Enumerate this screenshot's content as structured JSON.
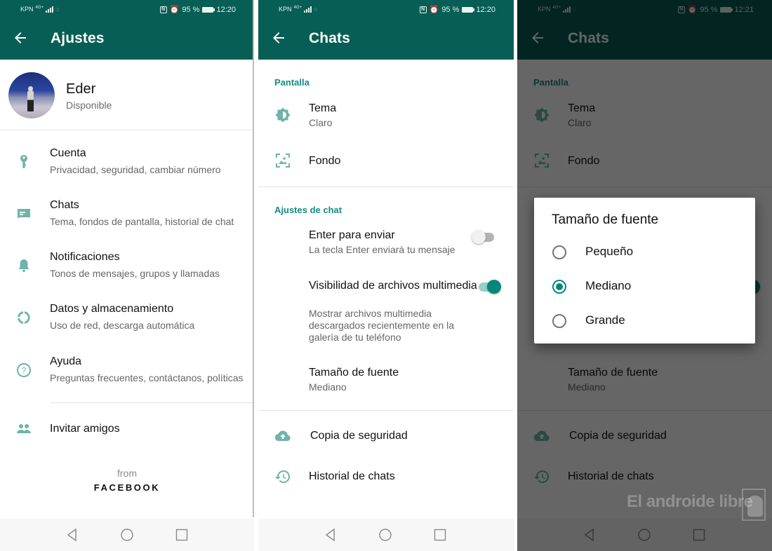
{
  "colors": {
    "primary_dark": "#075e54",
    "accent": "#00897b",
    "section_header": "#128c7e",
    "icon_tint": "#6fb3a8"
  },
  "panels": [
    {
      "status": {
        "carrier": "KPN",
        "network": "4G+",
        "battery": "95 %",
        "time": "12:20"
      },
      "appbar": {
        "title": "Ajustes",
        "back_icon": "arrow-left-icon"
      },
      "profile": {
        "name": "Eder",
        "status": "Disponible"
      },
      "items": [
        {
          "title": "Cuenta",
          "subtitle": "Privacidad, seguridad, cambiar número",
          "icon": "key-icon"
        },
        {
          "title": "Chats",
          "subtitle": "Tema, fondos de pantalla, historial de chat",
          "icon": "chat-icon"
        },
        {
          "title": "Notificaciones",
          "subtitle": "Tonos de mensajes, grupos y llamadas",
          "icon": "bell-icon"
        },
        {
          "title": "Datos y almacenamiento",
          "subtitle": "Uso de red, descarga automática",
          "icon": "data-usage-icon"
        },
        {
          "title": "Ayuda",
          "subtitle": "Preguntas frecuentes, contáctanos, políticas",
          "icon": "help-icon"
        },
        {
          "title": "Invitar amigos",
          "subtitle": "",
          "icon": "people-icon"
        }
      ],
      "footer": {
        "from": "from",
        "brand": "FACEBOOK"
      }
    },
    {
      "status": {
        "carrier": "KPN",
        "network": "4G+",
        "battery": "95 %",
        "time": "12:20"
      },
      "appbar": {
        "title": "Chats",
        "back_icon": "arrow-left-icon"
      },
      "sections": {
        "display_header": "Pantalla",
        "chat_settings_header": "Ajustes de chat"
      },
      "items": {
        "theme": {
          "title": "Tema",
          "subtitle": "Claro"
        },
        "wallpaper": {
          "title": "Fondo"
        },
        "enter_send": {
          "title": "Enter para enviar",
          "subtitle": "La tecla Enter enviará tu mensaje",
          "enabled": false
        },
        "media_visibility": {
          "title": "Visibilidad de archivos multimedia",
          "subtitle": "Mostrar archivos multimedia descargados recientemente en la galería de tu teléfono",
          "enabled": true
        },
        "font_size": {
          "title": "Tamaño de fuente",
          "subtitle": "Mediano"
        },
        "backup": {
          "title": "Copia de seguridad"
        },
        "history": {
          "title": "Historial de chats"
        }
      }
    },
    {
      "status": {
        "carrier": "KPN",
        "network": "4G+",
        "battery": "95 %",
        "time": "12:21"
      },
      "appbar": {
        "title": "Chats",
        "back_icon": "arrow-left-icon"
      },
      "dialog": {
        "title": "Tamaño de fuente",
        "options": [
          {
            "label": "Pequeño",
            "selected": false
          },
          {
            "label": "Mediano",
            "selected": true
          },
          {
            "label": "Grande",
            "selected": false
          }
        ]
      },
      "watermark": "El androide libre"
    }
  ]
}
